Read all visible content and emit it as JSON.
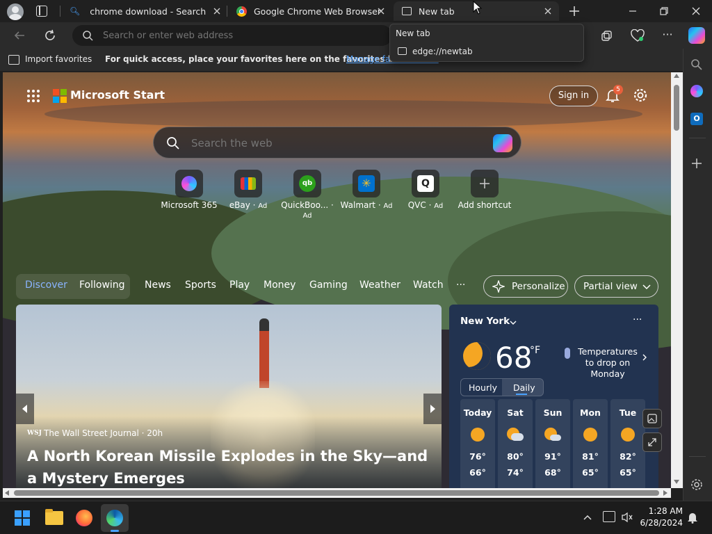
{
  "tabs": [
    {
      "title": "chrome download - Search",
      "icon": "bing-search-icon"
    },
    {
      "title": "Google Chrome Web Browser",
      "icon": "chrome-logo-icon"
    },
    {
      "title": "New tab",
      "icon": "newtab-icon",
      "active": true
    }
  ],
  "tooltip": {
    "title": "New tab",
    "url": "edge://newtab"
  },
  "address": {
    "placeholder": "Search or enter web address"
  },
  "favorites": {
    "import_label": "Import favorites",
    "message": "For quick access, place your favorites here on the favorites bar.",
    "manage_link": "Manage favorites now"
  },
  "page": {
    "brand": "Microsoft Start",
    "sign_in": "Sign in",
    "notification_count": "5",
    "search_placeholder": "Search the web",
    "shortcuts": [
      {
        "label": "Microsoft 365",
        "ad": ""
      },
      {
        "label": "eBay",
        "ad": "Ad"
      },
      {
        "label": "QuickBoo...",
        "ad": "Ad"
      },
      {
        "label": "Walmart",
        "ad": "Ad"
      },
      {
        "label": "QVC",
        "ad": "Ad"
      },
      {
        "label": "Add shortcut",
        "ad": ""
      }
    ],
    "nav": {
      "discover": "Discover",
      "following": "Following",
      "items": [
        "News",
        "Sports",
        "Play",
        "Money",
        "Gaming",
        "Weather",
        "Watch"
      ],
      "more": "···",
      "personalize": "Personalize",
      "view": "Partial view"
    },
    "feed": {
      "source_logo": "WSJ",
      "source": "The Wall Street Journal · 20h",
      "headline": "A North Korean Missile Explodes in the Sky—and a Mystery Emerges"
    },
    "weather": {
      "city": "New York",
      "temp": "68",
      "unit": "°F",
      "note": "Temperatures to drop on Monday",
      "tab_hourly": "Hourly",
      "tab_daily": "Daily",
      "days": [
        {
          "day": "Today",
          "hi": "76°",
          "lo": "66°",
          "icon": "sun-icon"
        },
        {
          "day": "Sat",
          "hi": "80°",
          "lo": "74°",
          "icon": "partly-cloudy-icon"
        },
        {
          "day": "Sun",
          "hi": "91°",
          "lo": "68°",
          "icon": "partly-cloudy-icon"
        },
        {
          "day": "Mon",
          "hi": "81°",
          "lo": "65°",
          "icon": "sun-icon"
        },
        {
          "day": "Tue",
          "hi": "82°",
          "lo": "65°",
          "icon": "sun-icon"
        }
      ]
    }
  },
  "taskbar": {
    "time": "1:28 AM",
    "date": "6/28/2024"
  },
  "colors": {
    "accent": "#4aa3ff",
    "weather_bg": "#223350",
    "link": "#5aa7ff"
  }
}
